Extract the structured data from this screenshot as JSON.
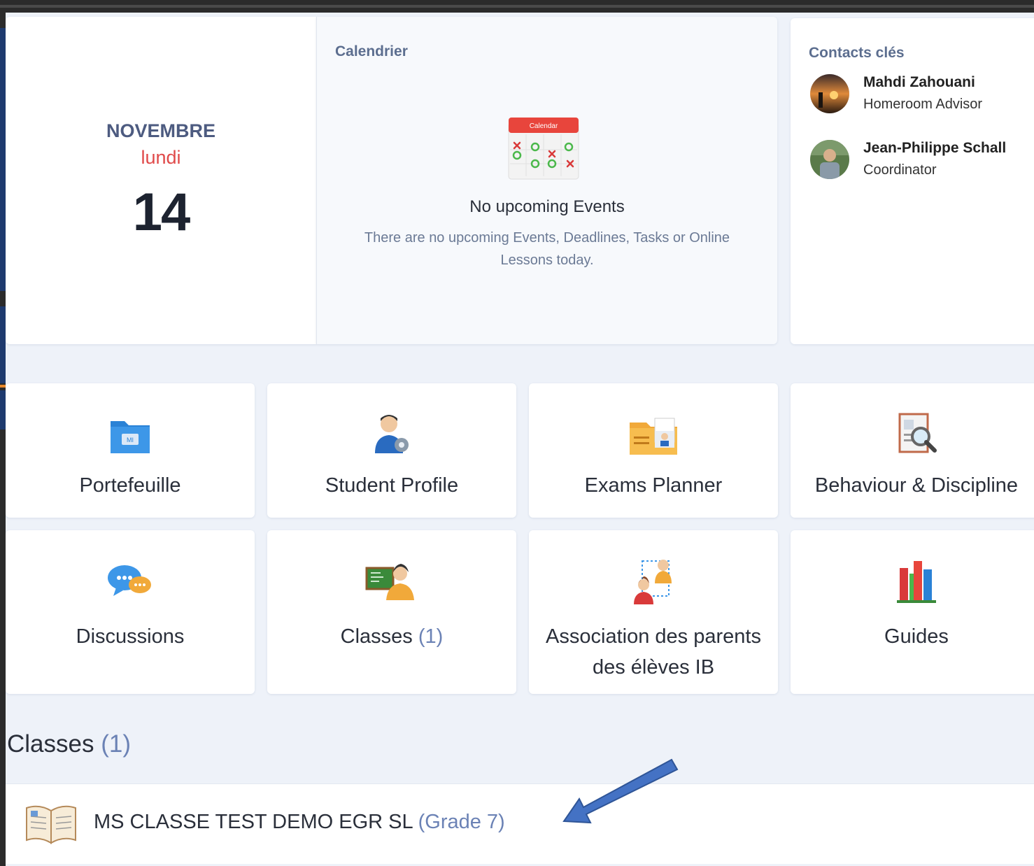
{
  "date": {
    "month": "NOVEMBRE",
    "weekday": "lundi",
    "day": "14"
  },
  "calendar": {
    "title": "Calendrier",
    "icon_label": "Calendar",
    "empty_title": "No upcoming Events",
    "empty_text": "There are no upcoming Events, Deadlines, Tasks or Online Lessons today."
  },
  "contacts": {
    "title": "Contacts clés",
    "items": [
      {
        "name": "Mahdi Zahouani",
        "role": "Homeroom Advisor"
      },
      {
        "name": "Jean-Philippe Schall",
        "role": "Coordinator"
      }
    ]
  },
  "tiles": [
    {
      "label": "Portefeuille",
      "icon": "portfolio-folder-icon"
    },
    {
      "label": "Student Profile",
      "icon": "student-profile-icon"
    },
    {
      "label": "Exams Planner",
      "icon": "exams-planner-icon"
    },
    {
      "label": "Behaviour & Discipline",
      "icon": "behaviour-discipline-icon"
    },
    {
      "label": "Discussions",
      "icon": "discussions-icon"
    },
    {
      "label": "Classes",
      "count": "(1)",
      "icon": "classes-icon"
    },
    {
      "label": "Association des parents des élèves IB",
      "icon": "association-icon"
    },
    {
      "label": "Guides",
      "icon": "guides-icon"
    }
  ],
  "classes_section": {
    "title": "Classes",
    "count": "(1)",
    "items": [
      {
        "name": "MS CLASSE TEST DEMO EGR SL",
        "grade": "(Grade 7)"
      }
    ]
  },
  "colors": {
    "accent_blue": "#6b82b5",
    "weekday_red": "#e04a4a",
    "annotation_arrow": "#4472c4"
  }
}
